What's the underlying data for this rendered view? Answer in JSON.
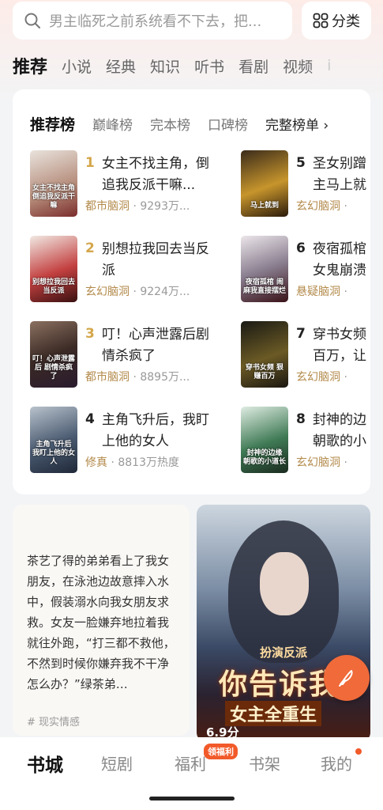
{
  "search": {
    "placeholder": "男主临死之前系统看不下去，把..."
  },
  "category_button": {
    "label": "分类",
    "icon": "grid-icon"
  },
  "tabs": [
    "推荐",
    "小说",
    "经典",
    "知识",
    "听书",
    "看剧",
    "视频",
    "i"
  ],
  "ranking": {
    "tabs": [
      "推荐榜",
      "巅峰榜",
      "完本榜",
      "口碑榜"
    ],
    "more_label": "完整榜单 ›",
    "books": [
      {
        "rank": "1",
        "title": "女主不找主角，倒追我反派干嘛...",
        "genre": "都市脑洞",
        "stats": " · 9293万...",
        "cover_text": "女主不找主角 倒追我反派干嘛"
      },
      {
        "rank": "2",
        "title": "别想拉我回去当反派",
        "genre": "玄幻脑洞",
        "stats": " · 9224万...",
        "cover_text": "别想拉我回去当反派"
      },
      {
        "rank": "3",
        "title": "叮！心声泄露后剧情杀疯了",
        "genre": "都市脑洞",
        "stats": " · 8895万...",
        "cover_text": "叮！心声泄露后 剧情杀疯了"
      },
      {
        "rank": "4",
        "title": "主角飞升后，我盯上他的女人",
        "genre": "修真",
        "stats": " · 8813万热度",
        "cover_text": "主角飞升后 我盯上他的女人"
      },
      {
        "rank": "5",
        "title": "圣女别蹭主马上就",
        "genre": "玄幻脑洞",
        "stats": " ·",
        "cover_text": "马上就到"
      },
      {
        "rank": "6",
        "title": "夜宿孤棺女鬼崩溃",
        "genre": "悬疑脑洞",
        "stats": " ·",
        "cover_text": "夜宿孤棺 闹麻我直接摆烂"
      },
      {
        "rank": "7",
        "title": "穿书女频百万，让",
        "genre": "玄幻脑洞",
        "stats": " ·",
        "cover_text": "穿书女频 狠赚百万"
      },
      {
        "rank": "8",
        "title": "封神的边朝歌的小",
        "genre": "玄幻脑洞",
        "stats": " ·",
        "cover_text": "封神的边缘 朝歌的小道长"
      }
    ]
  },
  "feed": {
    "left_text": "茶艺了得的弟弟看上了我女朋友，在泳池边故意摔入水中，假装溺水向我女朋友求救。女友一脸嫌弃地拉着我就往外跑，“打三都不救他，不然到时候你嫌弃我不干净怎么办？”绿茶弟…",
    "left_tag": "# 现实情感",
    "right_poster_line1": "扮演反派",
    "right_poster_line2": "你告诉我",
    "right_poster_line3": "女主全重生",
    "right_score": "6.9分"
  },
  "bottom_nav": {
    "items": [
      "书城",
      "短剧",
      "福利",
      "书架",
      "我的"
    ],
    "badge": "领福利"
  },
  "colors": {
    "accent": "#f06a3a",
    "rank_gold": "#d4a64a",
    "genre_gold": "#b38a4b"
  }
}
